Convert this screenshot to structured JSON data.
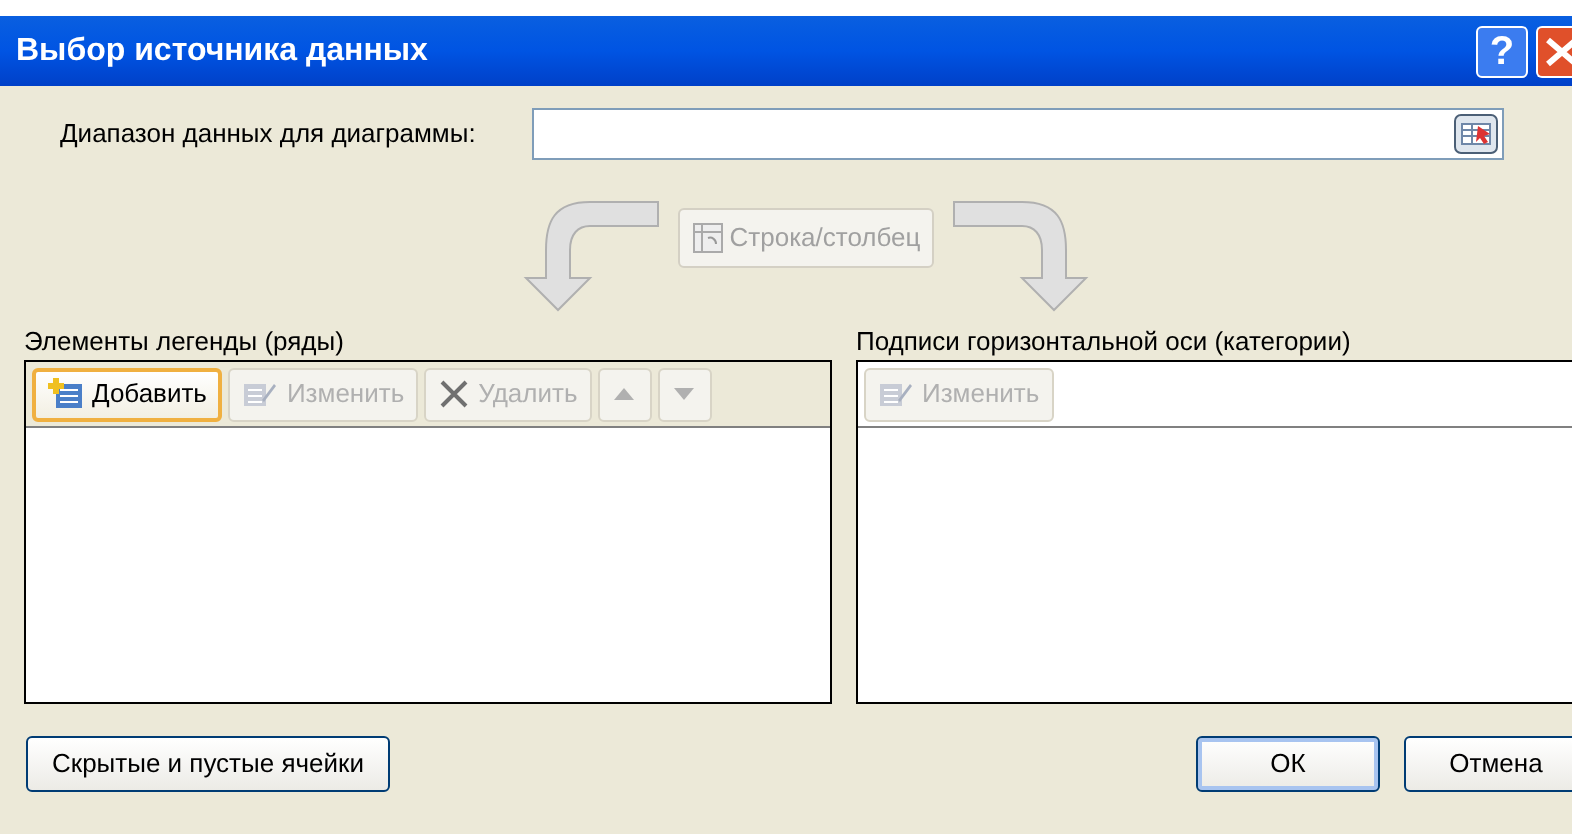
{
  "window": {
    "title": "Выбор источника данных",
    "controls": [
      {
        "kind": "help",
        "label": "?"
      },
      {
        "kind": "close"
      }
    ]
  },
  "range": {
    "label": "Диапазон данных для диаграммы:"
  },
  "switch_button": {
    "label": "Строка/столбец",
    "disabled": true
  },
  "legend": {
    "label": "Элементы легенды (ряды)",
    "buttons": [
      {
        "kind": "add",
        "label": "Добавить",
        "disabled": false,
        "focused": true
      },
      {
        "kind": "edit",
        "label": "Изменить",
        "disabled": true,
        "focused": false
      },
      {
        "kind": "delete",
        "label": "Удалить",
        "disabled": true,
        "focused": false
      },
      {
        "kind": "up",
        "disabled": true,
        "focused": false
      },
      {
        "kind": "down",
        "disabled": true,
        "focused": false
      }
    ]
  },
  "axis": {
    "label": "Подписи горизонтальной оси (категории)",
    "buttons": [
      {
        "kind": "edit",
        "label": "Изменить",
        "disabled": true,
        "focused": false
      }
    ]
  },
  "footer": {
    "hidden_cells_button": "Скрытые и пустые ячейки",
    "buttons": [
      "ОК",
      "Отмена"
    ]
  }
}
